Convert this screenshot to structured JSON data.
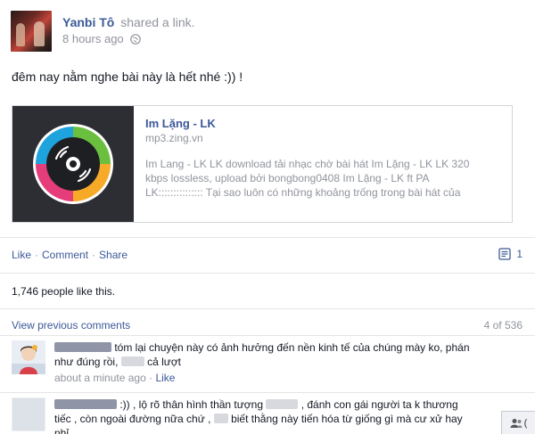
{
  "post": {
    "author": "Yanbi Tô",
    "shared_text": "shared a link.",
    "time": "8 hours ago",
    "status": "đêm nay nằm nghe bài này là hết nhé :)) !"
  },
  "link": {
    "title": "Im Lặng - LK",
    "domain": "mp3.zing.vn",
    "description_lines": [
      "Im Lang - LK LK download tải nhạc chờ bài hát Im Lặng - LK LK 320",
      "kbps lossless, upload bởi bongbong0408 Im Lặng - LK ft PA",
      "LK::::::::::::::: Tại sao luôn có những khoảng trống trong bài hát của"
    ]
  },
  "actions": {
    "like": "Like",
    "comment": "Comment",
    "share": "Share",
    "separator": "·",
    "comment_count": "1"
  },
  "likes_text": "1,746 people like this.",
  "comments_nav": {
    "view_previous": "View previous comments",
    "pager": "4 of 536"
  },
  "comments": [
    {
      "text_line1": "tóm lại chuyện này có ảnh hưởng đến nền kinh tế của chúng mày ko, phán",
      "text_line2a": "như đúng rồi,",
      "text_line2b": "cả lượt",
      "time": "about a minute ago",
      "like": "Like"
    },
    {
      "text_line1a": ":)) , lộ rõ thân hình thần tượng",
      "text_line1b": ", đánh con gái người ta k thương",
      "text_line2a": "tiếc , còn ngoài đường nữa chứ ,",
      "text_line2b": "biết thằng này tiến hóa từ giống gì mà cư xử hay",
      "text_line3": "nhỉ"
    }
  ],
  "chat": {
    "icon": "friends-icon",
    "label": "("
  },
  "colors": {
    "link_blue": "#3b5998",
    "meta_gray": "#90949c",
    "border": "#d3d6db"
  }
}
